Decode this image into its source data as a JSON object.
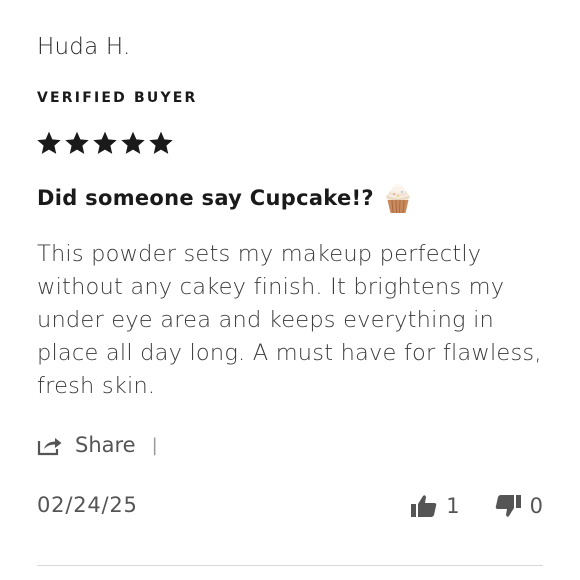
{
  "review": {
    "reviewer_name": "Huda H.",
    "verified_label": "VERIFIED BUYER",
    "rating": 5,
    "rating_max": 5,
    "title": "Did someone say Cupcake!?",
    "title_emoji": "cupcake-icon",
    "body": "This powder sets my makeup perfectly without any cakey finish. It brightens my under eye area and keeps everything in place all day long. A must have for flawless, fresh skin.",
    "date": "02/24/25"
  },
  "actions": {
    "share_label": "Share",
    "separator": "|",
    "helpful_count": "1",
    "unhelpful_count": "0"
  },
  "colors": {
    "text": "#1a1a1a",
    "muted": "#555555",
    "divider": "#d8d8d8"
  }
}
